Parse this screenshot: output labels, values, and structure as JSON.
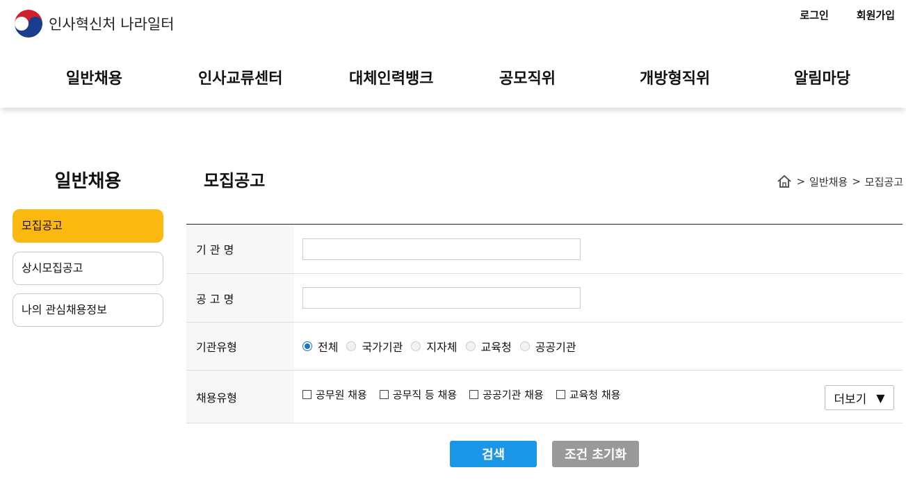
{
  "header": {
    "logo_text": "인사혁신처 나라일터",
    "util": {
      "login": "로그인",
      "signup": "회원가입"
    },
    "gnb": [
      {
        "label": "일반채용"
      },
      {
        "label": "인사교류센터"
      },
      {
        "label": "대체인력뱅크"
      },
      {
        "label": "공모직위"
      },
      {
        "label": "개방형직위"
      },
      {
        "label": "알림마당"
      }
    ]
  },
  "sidebar": {
    "title": "일반채용",
    "items": [
      {
        "label": "모집공고",
        "active": true
      },
      {
        "label": "상시모집공고",
        "active": false
      },
      {
        "label": "나의 관심채용정보",
        "active": false
      }
    ]
  },
  "main": {
    "title": "모집공고",
    "breadcrumb": {
      "sep1": ">",
      "level1": "일반채용",
      "sep2": ">",
      "level2": "모집공고"
    }
  },
  "form": {
    "org_name": {
      "label": "기 관 명",
      "value": ""
    },
    "notice_name": {
      "label": "공 고 명",
      "value": ""
    },
    "org_type": {
      "label": "기관유형",
      "options": [
        "전체",
        "국가기관",
        "지자체",
        "교육청",
        "공공기관"
      ],
      "selected": "전체"
    },
    "hire_type": {
      "label": "채용유형",
      "options": [
        "공무원 채용",
        "공무직 등 채용",
        "공공기관 채용",
        "교육청 채용"
      ],
      "more": "더보기",
      "more_icon": "triangle-down-icon"
    }
  },
  "buttons": {
    "search": "검색",
    "reset": "조건 초기화"
  },
  "colors": {
    "accent_yellow": "#fbb811",
    "search_blue": "#1a96e6",
    "reset_gray": "#999999",
    "radio_blue": "#1a73c8"
  }
}
